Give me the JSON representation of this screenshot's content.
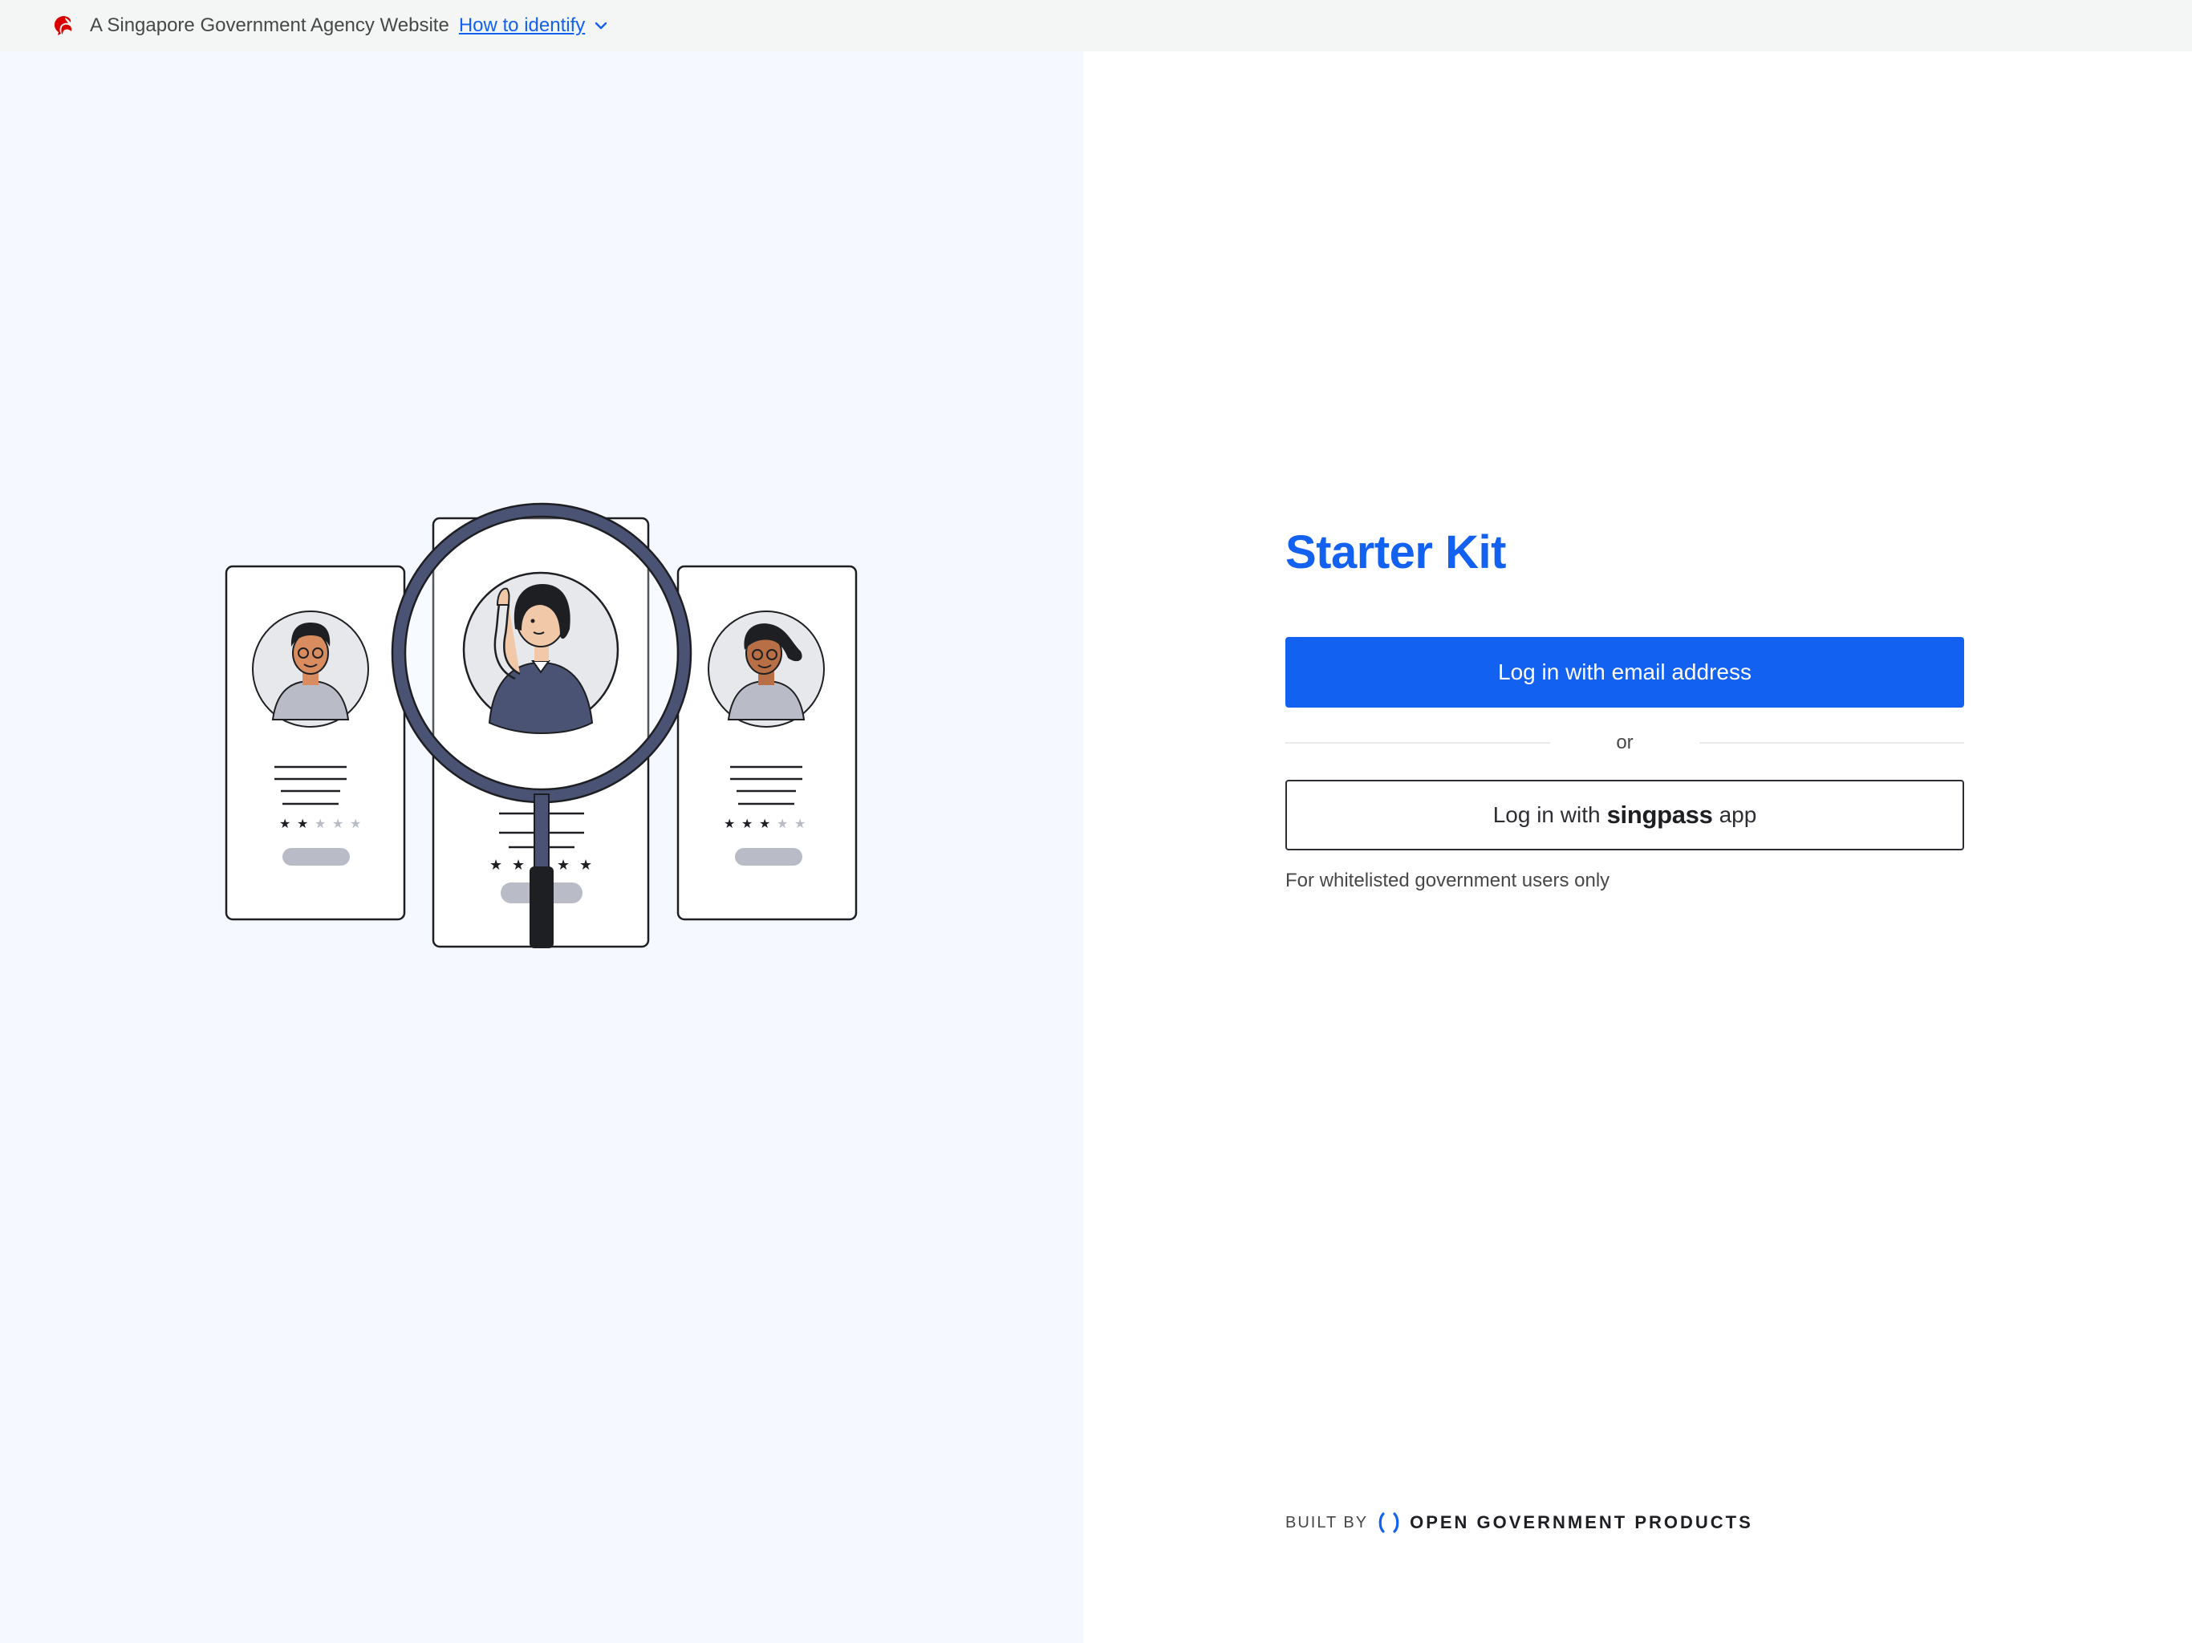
{
  "masthead": {
    "agency_text": "A Singapore Government Agency Website",
    "identify_link": "How to identify",
    "lion_icon": "singapore-lion-icon",
    "chevron_icon": "chevron-down-icon"
  },
  "login": {
    "title": "Starter Kit",
    "email_button": "Log in with email address",
    "divider_text": "or",
    "singpass_prefix": "Log in with",
    "singpass_brand": "singpass",
    "singpass_suffix": "app",
    "note": "For whitelisted government users only"
  },
  "footer": {
    "built_by": "BUILT BY",
    "org_name": "OPEN GOVERNMENT PRODUCTS"
  },
  "colors": {
    "primary": "#1361f0",
    "left_panel_bg": "#f5f8fe",
    "masthead_bg": "#f4f6f5",
    "lion_red": "#db0000"
  },
  "illustration": {
    "icon": "profile-search-illustration",
    "ratings": [
      2,
      5,
      3
    ]
  }
}
